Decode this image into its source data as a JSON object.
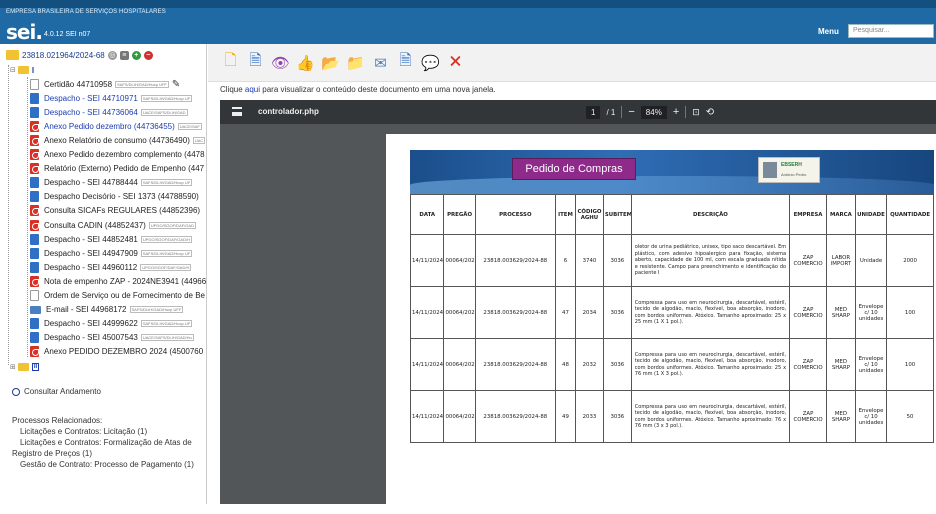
{
  "header": {
    "org_name": "EMPRESA BRASILEIRA DE SERVIÇOS HOSPITALARES",
    "logo": "sei.",
    "version": "4.0.12 SEI n07",
    "menu_label": "Menu",
    "search_placeholder": "Pesquisar..."
  },
  "sidebar": {
    "process_number": "23818.021964/2024-68",
    "folder_label": "I",
    "folder2_label": "II",
    "documents": [
      {
        "label": "Certidão 44710958",
        "tag": "SAFS/DLIH/GAD/Hucp UFF",
        "type": "blank",
        "blue": false
      },
      {
        "label": "Despacho - SEI 44710971",
        "tag": "SAFS/DLIH/GAD/Hucp UF",
        "type": "word",
        "blue": true
      },
      {
        "label": "Despacho - SEI 44736064",
        "tag": "UACE/SAFS/DLIH/GAD",
        "type": "word",
        "blue": true
      },
      {
        "label": "Anexo Pedido dezembro (44736455)",
        "tag": "UACE/SAF",
        "type": "pdf",
        "blue": true
      },
      {
        "label": "Anexo Relatório de consumo (44736490)",
        "tag": "UAC",
        "type": "pdf",
        "blue": false
      },
      {
        "label": "Anexo Pedido dezembro complemento (4478",
        "tag": "",
        "type": "pdf",
        "blue": false
      },
      {
        "label": "Relatório (Externo) Pedido de Empenho (447",
        "tag": "",
        "type": "pdf",
        "blue": false
      },
      {
        "label": "Despacho - SEI 44788444",
        "tag": "SAFS/DLIH/GAD/Hucp UF",
        "type": "word",
        "blue": false
      },
      {
        "label": "Despacho Decisório - SEI 1373 (44788590)",
        "tag": "",
        "type": "word",
        "blue": false
      },
      {
        "label": "Consulta SICAFs REGULARES (44852396)",
        "tag": "",
        "type": "pdf",
        "blue": false
      },
      {
        "label": "Consulta CADIN (44852437)",
        "tag": "UPGO/SGOF/DAF/GAD",
        "type": "pdf",
        "blue": false
      },
      {
        "label": "Despacho - SEI 44852481",
        "tag": "UPGO/SGOF/DAF/GAD/H",
        "type": "word",
        "blue": false
      },
      {
        "label": "Despacho - SEI 44947909",
        "tag": "SAFS/DLIH/GAD/Hucp UF",
        "type": "word",
        "blue": false
      },
      {
        "label": "Despacho - SEI 44960112",
        "tag": "UPGO/SGOF/DAF/GAD/H",
        "type": "word",
        "blue": false
      },
      {
        "label": "Nota de empenho ZAP - 2024NE3941 (44966",
        "tag": "",
        "type": "pdf",
        "blue": false
      },
      {
        "label": "Ordem de Serviço ou de Fornecimento de Be",
        "tag": "",
        "type": "blank",
        "blue": false
      },
      {
        "label": "E-mail - SEI 44968172",
        "tag": "SAFS/DLIH/GAD/Hucp UFF",
        "type": "mail",
        "blue": false
      },
      {
        "label": "Despacho - SEI 44999622",
        "tag": "SAFS/DLIH/GAD/Hucp UF",
        "type": "word",
        "blue": false
      },
      {
        "label": "Despacho - SEI 45007543",
        "tag": "UACE/SAFS/DLIH/GAD/Hu",
        "type": "word",
        "blue": false
      },
      {
        "label": "Anexo PEDIDO DEZEMBRO 2024 (4500760",
        "tag": "",
        "type": "pdf",
        "blue": false
      }
    ],
    "consult_label": "Consultar Andamento",
    "related_title": "Processos Relacionados:",
    "related": [
      "Licitações e Contratos: Licitação (1)",
      "Licitações e Contratos: Formalização de Atas de",
      "Registro de Preços (1)",
      "Gestão de Contrato: Processo de Pagamento (1)"
    ]
  },
  "main": {
    "notice_prefix": "Clique ",
    "notice_link": "aqui",
    "notice_suffix": " para visualizar o conteúdo deste documento em uma nova janela.",
    "viewer": {
      "filename": "controlador.php",
      "page_current": "1",
      "page_total": "/ 1",
      "zoom": "84%"
    },
    "doc": {
      "title": "Pedido de Compras",
      "logo_text": "EBSERH",
      "logo_sub": "Antônio Pedro",
      "headers": [
        "DATA",
        "PREGÃO",
        "PROCESSO",
        "ITEM",
        "CÓDIGO AGHU",
        "SUBITEM",
        "DESCRIÇÃO",
        "EMPRESA",
        "MARCA",
        "UNIDADE",
        "QUANTIDADE"
      ],
      "rows": [
        [
          "14/11/2024",
          "00064/2024",
          "23818.003629/2024-88",
          "6",
          "3740",
          "3036",
          "oletor de urina pediátrico, unisex, tipo saco descartável. Em plástico, com adesivo hipoalergico para fixação, sistema aberto, capacidade de 100 ml, com escala graduada nítida e resistente. Campo para preenchimento e identificação do paciente I",
          "ZAP COMERCIO",
          "LABOR IMPORT",
          "Unidade",
          "2000"
        ],
        [
          "14/11/2024",
          "00064/2024",
          "23818.003629/2024-88",
          "47",
          "2034",
          "3036",
          "Compressa para uso em neurocirurgia, descartável, estéril, tecido de algodão, macio, flexível, boa absorção, inodoro, com bordos uniformes. Atóxico. Tamanho aproximado: 25 x 25 mm (1 X 1 pol.).",
          "ZAP COMERCIO",
          "MED SHARP",
          "Envelope c/ 10 unidades",
          "100"
        ],
        [
          "14/11/2024",
          "00064/2024",
          "23818.003629/2024-88",
          "48",
          "2032",
          "3036",
          "Compressa para uso em neurocirurgia, descartável, estéril, tecido de algodão, macio, flexível, boa absorção, inodoro, com bordos uniformes. Atóxico. Tamanho aproximado: 25 x 76 mm (1 X 3 pol.).",
          "ZAP COMERCIO",
          "MED SHARP",
          "Envelope c/ 10 unidades",
          "100"
        ],
        [
          "14/11/2024",
          "00064/2024",
          "23818.003629/2024-88",
          "49",
          "2033",
          "3036",
          "Compressa para uso em neurocirurgia, descartável, estéril, tecido de algodão, macio, flexível, boa absorção, inodoro, com bordos uniformes. Atóxico. Tamanho aproximado: 76 x 76 mm (3 x 3 pol.).",
          "ZAP COMERCIO",
          "MED SHARP",
          "Envelope c/ 10 unidades",
          "50"
        ]
      ]
    }
  },
  "colors": {
    "header_blue": "#1f6aa5",
    "link_blue": "#1a3cb0",
    "pdf_red": "#d93025",
    "word_blue": "#2f6fc6",
    "title_purple": "#8e2a8a"
  }
}
